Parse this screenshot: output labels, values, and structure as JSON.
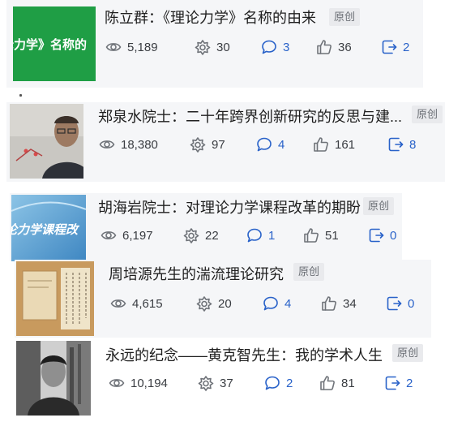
{
  "articles": [
    {
      "title": "陈立群：《理论力学》名称的由来",
      "badge": "原创",
      "thumb_text": "论力学》名称的",
      "views": "5,189",
      "shares_ring": "30",
      "comments": "3",
      "likes": "36",
      "forwards": "2"
    },
    {
      "title": "郑泉水院士：二十年跨界创新研究的反思与建...",
      "badge": "原创",
      "views": "18,380",
      "shares_ring": "97",
      "comments": "4",
      "likes": "161",
      "forwards": "8"
    },
    {
      "title": "胡海岩院士：对理论力学课程改革的期盼",
      "badge": "原创",
      "thumb_text": "论力学课程改",
      "views": "6,197",
      "shares_ring": "22",
      "comments": "1",
      "likes": "51",
      "forwards": "0"
    },
    {
      "title": "周培源先生的湍流理论研究",
      "badge": "原创",
      "views": "4,615",
      "shares_ring": "20",
      "comments": "4",
      "likes": "34",
      "forwards": "0"
    },
    {
      "title": "永远的纪念——黄克智先生：我的学术人生",
      "badge": "原创",
      "views": "10,194",
      "shares_ring": "37",
      "comments": "2",
      "likes": "81",
      "forwards": "2"
    }
  ],
  "colors": {
    "accent": "#2962c9",
    "card_bg": "#f5f6f8",
    "thumb1_green": "#1f9e45"
  }
}
